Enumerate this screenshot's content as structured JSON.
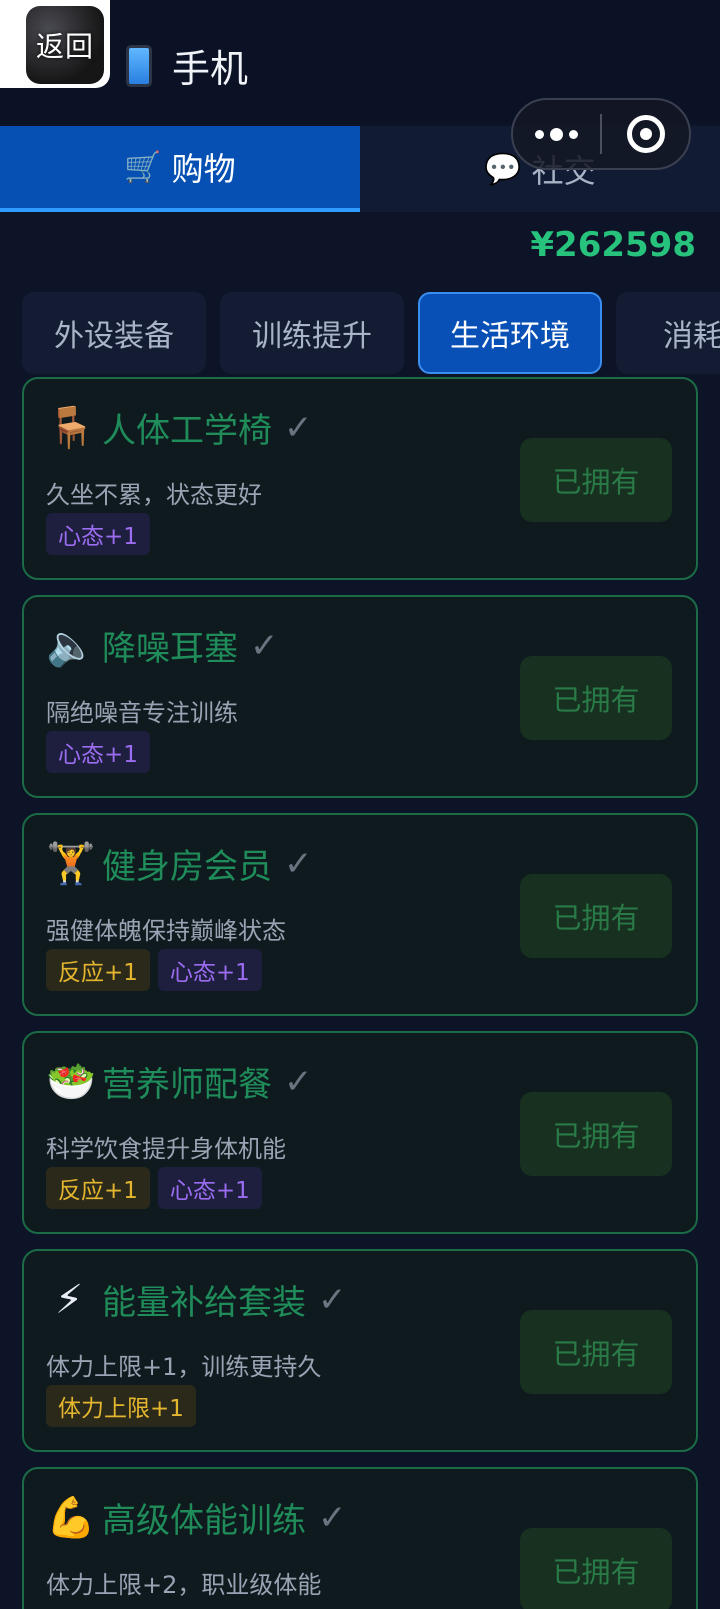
{
  "header": {
    "back_label": "返回",
    "title": "手机",
    "title_icon": "mobile-phone-icon"
  },
  "top_tabs": [
    {
      "icon": "🛒",
      "label": "购物",
      "active": true
    },
    {
      "icon": "💬",
      "label": "社交",
      "active": false
    }
  ],
  "balance": "¥262598",
  "category_tabs": [
    {
      "label": "外设装备",
      "active": false
    },
    {
      "label": "训练提升",
      "active": false
    },
    {
      "label": "生活环境",
      "active": true
    },
    {
      "label": "消耗品",
      "active": false
    }
  ],
  "items": [
    {
      "icon": "🪑",
      "name": "人体工学椅",
      "check": "✓",
      "desc": "久坐不累，状态更好",
      "tags": [
        {
          "text": "心态+1",
          "type": "mind"
        }
      ],
      "button": "已拥有"
    },
    {
      "icon": "🔈",
      "name": "降噪耳塞",
      "check": "✓",
      "desc": "隔绝噪音专注训练",
      "tags": [
        {
          "text": "心态+1",
          "type": "mind"
        }
      ],
      "button": "已拥有"
    },
    {
      "icon": "🏋",
      "name": "健身房会员",
      "check": "✓",
      "desc": "强健体魄保持巅峰状态",
      "tags": [
        {
          "text": "反应+1",
          "type": "react"
        },
        {
          "text": "心态+1",
          "type": "mind"
        }
      ],
      "button": "已拥有"
    },
    {
      "icon": "🥗",
      "name": "营养师配餐",
      "check": "✓",
      "desc": "科学饮食提升身体机能",
      "tags": [
        {
          "text": "反应+1",
          "type": "react"
        },
        {
          "text": "心态+1",
          "type": "mind"
        }
      ],
      "button": "已拥有"
    },
    {
      "icon": "⚡",
      "name": "能量补给套装",
      "check": "✓",
      "desc": "体力上限+1，训练更持久",
      "tags": [
        {
          "text": "体力上限+1",
          "type": "stamina"
        }
      ],
      "button": "已拥有"
    },
    {
      "icon": "💪",
      "name": "高级体能训练",
      "check": "✓",
      "desc": "体力上限+2，职业级体能",
      "tags": [],
      "button": "已拥有"
    }
  ]
}
